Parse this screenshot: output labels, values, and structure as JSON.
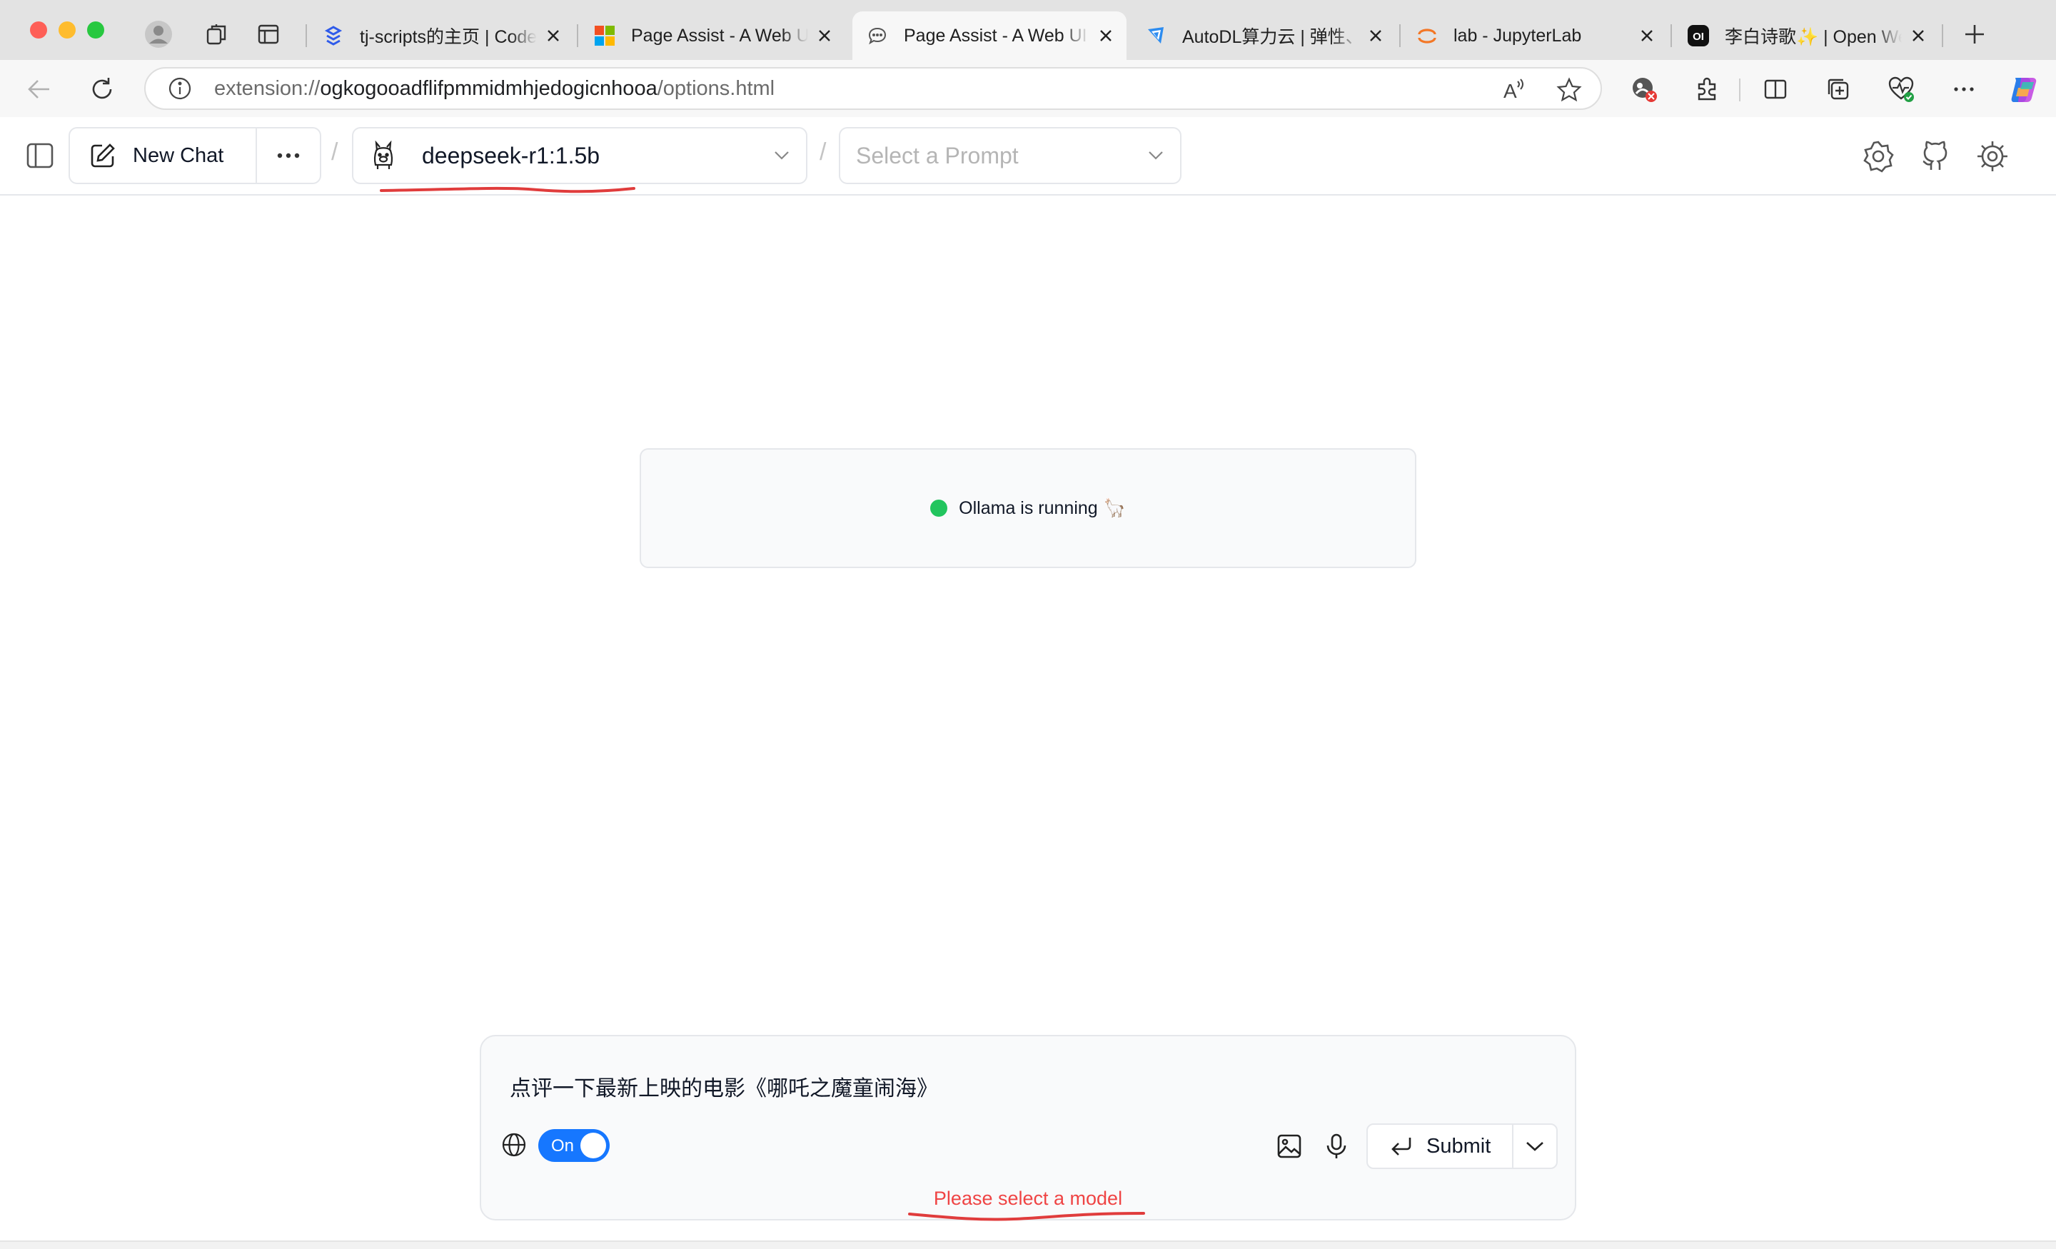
{
  "browser": {
    "tabs": [
      {
        "label": "tj-scripts的主页 | CodeWiki",
        "favicon": "tj-scripts-logo-icon",
        "active": false
      },
      {
        "label": "Page Assist - A Web UI",
        "favicon": "microsoft-logo-icon",
        "active": false
      },
      {
        "label": "Page Assist - A Web UI",
        "favicon": "chat-bubble-icon",
        "active": true
      },
      {
        "label": "AutoDL算力云 | 弹性、好用",
        "favicon": "autodl-logo-icon",
        "active": false
      },
      {
        "label": "lab - JupyterLab",
        "favicon": "jupyter-logo-icon",
        "active": false
      },
      {
        "label": "李白诗歌✨ | Open WebUI",
        "favicon": "openwebui-logo-icon",
        "active": false
      }
    ],
    "open_webui_badge": "OI",
    "url": {
      "scheme": "extension://",
      "host": "ogkogooadflifpmmidmhjedogicnhooa",
      "path": "/options.html"
    },
    "read_aloud_label": "A"
  },
  "header": {
    "new_chat_label": "New Chat",
    "model_value": "deepseek-r1:1.5b",
    "prompt_placeholder": "Select a Prompt",
    "separator": "/"
  },
  "status": {
    "text": "Ollama is running",
    "emoji": "🦙",
    "dot_color": "#22c55e"
  },
  "composer": {
    "input_value": "点评一下最新上映的电影《哪吒之魔童闹海》",
    "web_search_toggle_label": "On",
    "submit_label": "Submit",
    "error_message": "Please select a model"
  },
  "colors": {
    "accent_blue": "#1677ff",
    "error_red": "#ef4444",
    "annotation_red": "#e03c3c"
  }
}
